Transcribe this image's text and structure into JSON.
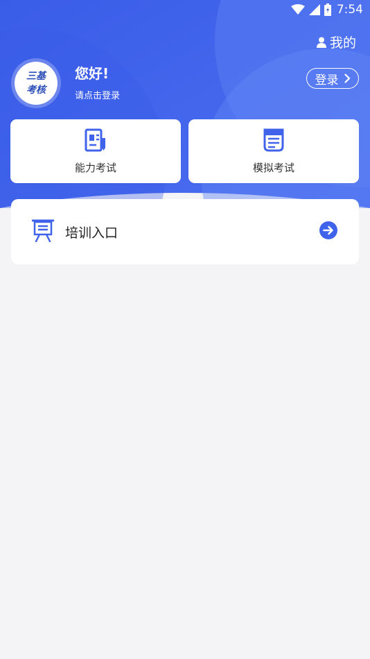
{
  "status_bar": {
    "time": "7:54",
    "icons": [
      "wifi-icon",
      "signal-icon",
      "battery-icon"
    ]
  },
  "header": {
    "mine_label": "我的",
    "avatar_line1": "三基",
    "avatar_line2": "考核",
    "greeting": "您好!",
    "login_prompt": "请点击登录",
    "login_button": "登录"
  },
  "cards": [
    {
      "label": "能力考试",
      "icon": "exam-paper-icon"
    },
    {
      "label": "模拟考试",
      "icon": "document-icon"
    }
  ],
  "training": {
    "label": "培训入口",
    "icon": "presentation-board-icon",
    "action_icon": "arrow-right-circle-icon"
  },
  "colors": {
    "primary": "#3f63ea",
    "primary_light": "#5a7df2",
    "background": "#f4f4f6"
  }
}
